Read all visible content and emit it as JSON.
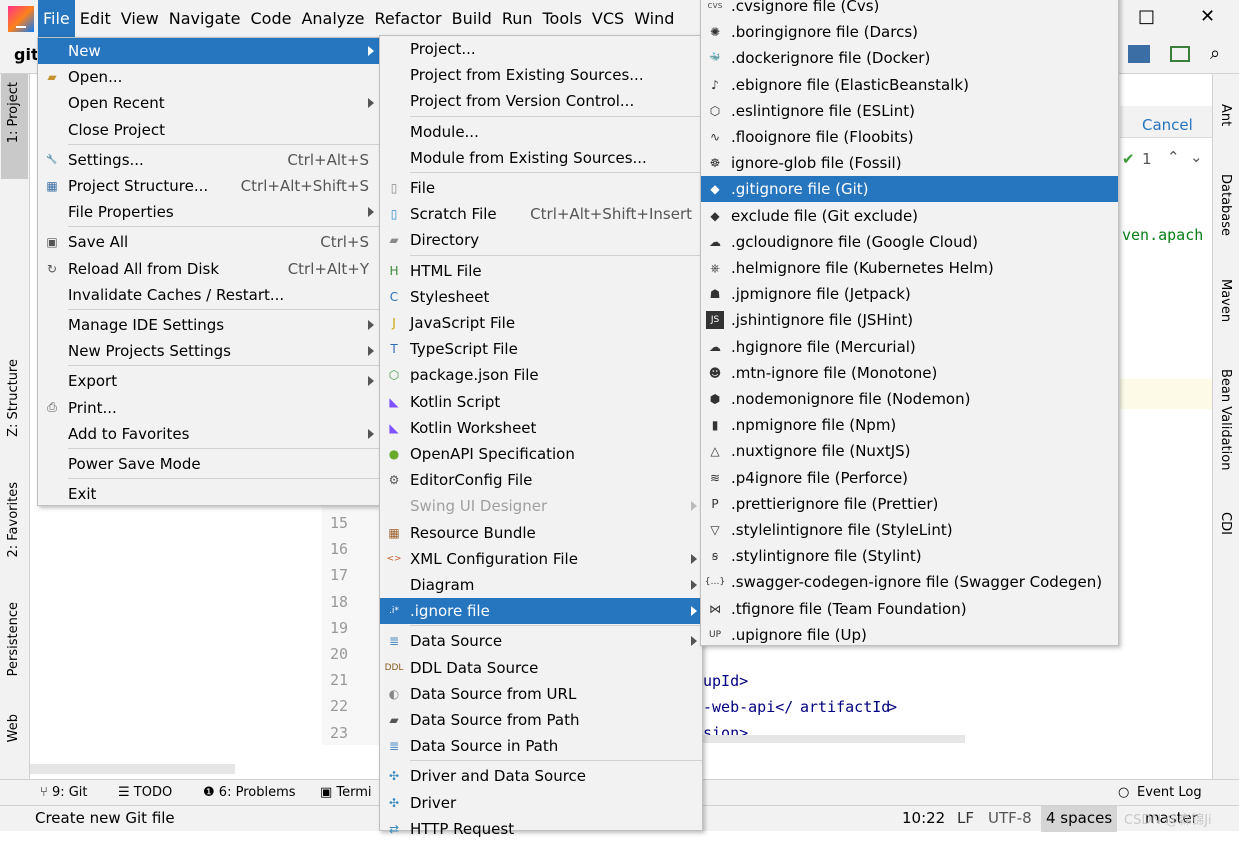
{
  "menubar": {
    "items": [
      "File",
      "Edit",
      "View",
      "Navigate",
      "Code",
      "Analyze",
      "Refactor",
      "Build",
      "Run",
      "Tools",
      "VCS",
      "Wind"
    ]
  },
  "toolbar": {
    "project_name": "git"
  },
  "window_controls": {
    "maximize": "□",
    "close": "✕"
  },
  "left_tabs": [
    "1: Project",
    "Z: Structure",
    "2: Favorites",
    "Persistence",
    "Web"
  ],
  "right_tabs": [
    "Ant",
    "Database",
    "Maven",
    "Bean Validation",
    "CDI"
  ],
  "editor": {
    "cancel": "Cancel",
    "inspection_count": "1",
    "line_numbers": [
      "15",
      "16",
      "17",
      "18",
      "19",
      "20",
      "21",
      "22",
      "23"
    ],
    "code_lines": [
      "ven.apach",
      "upId>",
      "-web-api</",
      "artifactId",
      ">",
      "sion>"
    ]
  },
  "file_menu": [
    {
      "label": "New",
      "sel": true,
      "sub": true,
      "icon": ""
    },
    {
      "label": "Open...",
      "icon": "folder-icon"
    },
    {
      "label": "Open Recent",
      "sub": true
    },
    {
      "label": "Close Project"
    },
    {
      "label": "Settings...",
      "shortcut": "Ctrl+Alt+S",
      "icon": "wrench-icon"
    },
    {
      "label": "Project Structure...",
      "shortcut": "Ctrl+Alt+Shift+S",
      "icon": "project-structure-icon"
    },
    {
      "label": "File Properties",
      "sub": true
    },
    {
      "label": "Save All",
      "shortcut": "Ctrl+S",
      "icon": "save-icon"
    },
    {
      "label": "Reload All from Disk",
      "shortcut": "Ctrl+Alt+Y",
      "icon": "reload-icon"
    },
    {
      "label": "Invalidate Caches / Restart..."
    },
    {
      "label": "Manage IDE Settings",
      "sub": true
    },
    {
      "label": "New Projects Settings",
      "sub": true
    },
    {
      "label": "Export",
      "sub": true
    },
    {
      "label": "Print...",
      "icon": "print-icon"
    },
    {
      "label": "Add to Favorites",
      "sub": true
    },
    {
      "label": "Power Save Mode"
    },
    {
      "label": "Exit"
    }
  ],
  "new_menu": [
    {
      "label": "Project..."
    },
    {
      "label": "Project from Existing Sources..."
    },
    {
      "label": "Project from Version Control..."
    },
    {
      "label": "Module..."
    },
    {
      "label": "Module from Existing Sources..."
    },
    {
      "label": "File",
      "icon": "file-icon"
    },
    {
      "label": "Scratch File",
      "shortcut": "Ctrl+Alt+Shift+Insert",
      "icon": "scratch-file-icon"
    },
    {
      "label": "Directory",
      "icon": "directory-icon"
    },
    {
      "label": "HTML File",
      "icon": "html-file-icon"
    },
    {
      "label": "Stylesheet",
      "icon": "css-file-icon"
    },
    {
      "label": "JavaScript File",
      "icon": "js-file-icon"
    },
    {
      "label": "TypeScript File",
      "icon": "ts-file-icon"
    },
    {
      "label": "package.json File",
      "icon": "nodejs-icon"
    },
    {
      "label": "Kotlin Script",
      "icon": "kotlin-icon"
    },
    {
      "label": "Kotlin Worksheet",
      "icon": "kotlin-icon"
    },
    {
      "label": "OpenAPI Specification",
      "icon": "openapi-icon"
    },
    {
      "label": "EditorConfig File",
      "icon": "editorconfig-icon"
    },
    {
      "label": "Swing UI Designer",
      "disabled": true,
      "sub": true
    },
    {
      "label": "Resource Bundle",
      "icon": "resource-bundle-icon"
    },
    {
      "label": "XML Configuration File",
      "sub": true,
      "icon": "xml-icon"
    },
    {
      "label": "Diagram",
      "sub": true
    },
    {
      "label": ".ignore file",
      "sel": true,
      "sub": true,
      "icon": "ignore-file-icon"
    },
    {
      "label": "Data Source",
      "sub": true,
      "icon": "database-icon"
    },
    {
      "label": "DDL Data Source",
      "icon": "ddl-icon"
    },
    {
      "label": "Data Source from URL",
      "icon": "url-datasource-icon"
    },
    {
      "label": "Data Source from Path",
      "icon": "folder-open-icon"
    },
    {
      "label": "Data Source in Path",
      "icon": "database-icon"
    },
    {
      "label": "Driver and Data Source",
      "icon": "driver-icon"
    },
    {
      "label": "Driver",
      "icon": "driver-icon"
    },
    {
      "label": "HTTP Request",
      "icon": "http-icon"
    }
  ],
  "ignore_menu": [
    {
      "label": ".cvsignore file (Cvs)",
      "icon": "cvs-icon"
    },
    {
      "label": ".boringignore file (Darcs)",
      "icon": "darcs-icon"
    },
    {
      "label": ".dockerignore file (Docker)",
      "icon": "docker-icon"
    },
    {
      "label": ".ebignore file (ElasticBeanstalk)",
      "icon": "beanstalk-icon"
    },
    {
      "label": ".eslintignore file (ESLint)",
      "icon": "eslint-icon"
    },
    {
      "label": ".flooignore file (Floobits)",
      "icon": "floobits-icon"
    },
    {
      "label": "ignore-glob file (Fossil)",
      "icon": "fossil-icon"
    },
    {
      "label": ".gitignore file (Git)",
      "sel": true,
      "icon": "git-icon"
    },
    {
      "label": "exclude file (Git exclude)",
      "icon": "git-icon"
    },
    {
      "label": ".gcloudignore file (Google Cloud)",
      "icon": "cloud-icon"
    },
    {
      "label": ".helmignore file (Kubernetes Helm)",
      "icon": "helm-icon"
    },
    {
      "label": ".jpmignore file (Jetpack)",
      "icon": "jetpack-icon"
    },
    {
      "label": ".jshintignore file (JSHint)",
      "icon": "jshint-icon"
    },
    {
      "label": ".hgignore file (Mercurial)",
      "icon": "mercurial-icon"
    },
    {
      "label": ".mtn-ignore file (Monotone)",
      "icon": "monotone-icon"
    },
    {
      "label": ".nodemonignore file (Nodemon)",
      "icon": "nodemon-icon"
    },
    {
      "label": ".npmignore file (Npm)",
      "icon": "npm-icon"
    },
    {
      "label": ".nuxtignore file (NuxtJS)",
      "icon": "nuxt-icon"
    },
    {
      "label": ".p4ignore file (Perforce)",
      "icon": "perforce-icon"
    },
    {
      "label": ".prettierignore file (Prettier)",
      "icon": "prettier-icon"
    },
    {
      "label": ".stylelintignore file (StyleLint)",
      "icon": "stylelint-icon"
    },
    {
      "label": ".stylintignore file (Stylint)",
      "icon": "stylint-icon"
    },
    {
      "label": ".swagger-codegen-ignore file (Swagger Codegen)",
      "icon": "swagger-icon"
    },
    {
      "label": ".tfignore file (Team Foundation)",
      "icon": "vs-icon"
    },
    {
      "label": ".upignore file (Up)",
      "icon": "up-icon"
    }
  ],
  "status_tools": [
    {
      "label": "9: Git",
      "icon": "git-branch-icon"
    },
    {
      "label": "TODO",
      "icon": "todo-icon"
    },
    {
      "label": "6: Problems",
      "icon": "problems-icon"
    },
    {
      "label": "Termi",
      "icon": "terminal-icon"
    }
  ],
  "event_log": "Event Log",
  "status": {
    "message": "Create new Git file",
    "position": "10:22",
    "line_sep": "LF",
    "encoding": "UTF-8",
    "indent": "4 spaces",
    "branch": "master",
    "watermark": "CSDN @森锦Ji"
  }
}
